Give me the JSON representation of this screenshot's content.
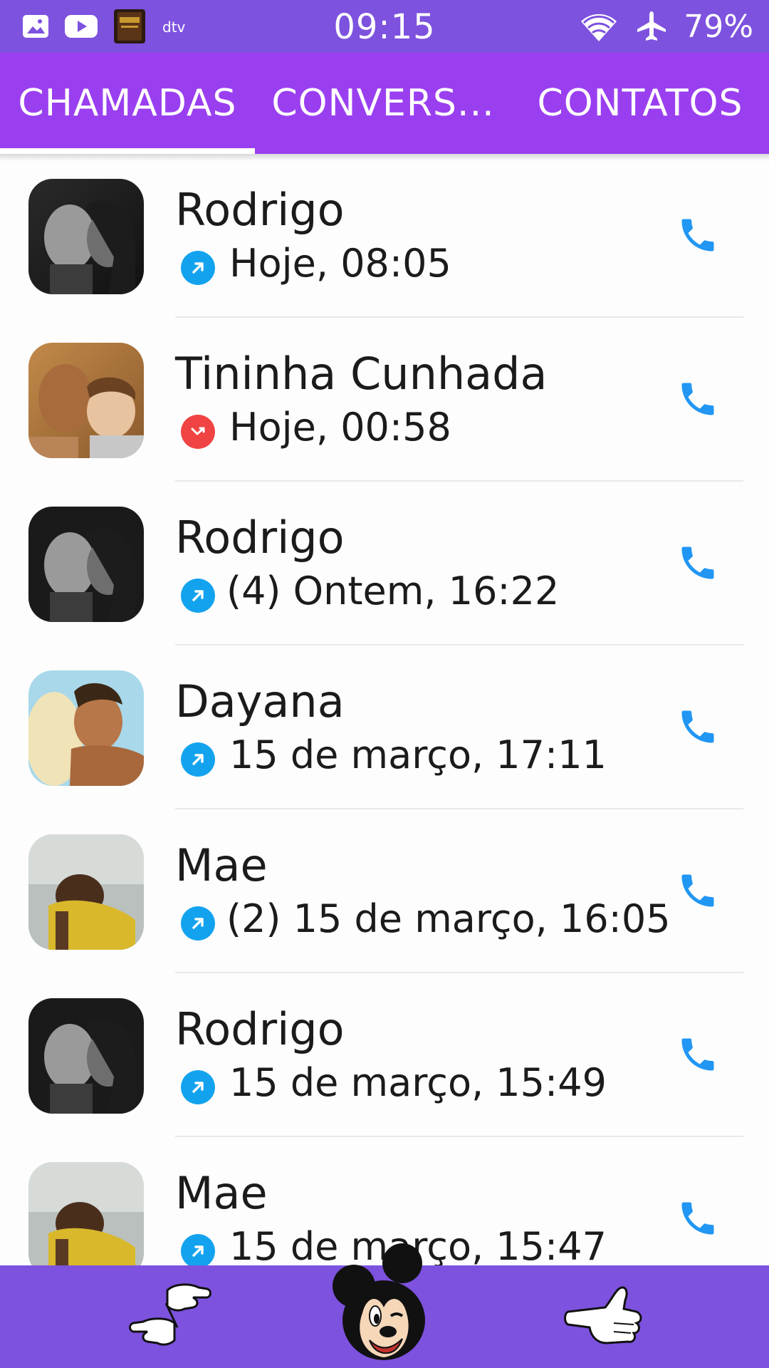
{
  "status_bar": {
    "time": "09:15",
    "battery": "79%",
    "left_icons": [
      "gallery-icon",
      "youtube-icon",
      "bible-app-icon",
      "dtv-icon"
    ],
    "right_icons": [
      "wifi-icon",
      "airplane-icon"
    ]
  },
  "tabs": [
    {
      "label": "CHAMADAS",
      "selected": true
    },
    {
      "label": "CONVERS...",
      "selected": false
    },
    {
      "label": "CONTATOS",
      "selected": false
    }
  ],
  "calls": [
    {
      "name": "Rodrigo",
      "detail": "Hoje, 08:05",
      "direction": "outgoing"
    },
    {
      "name": "Tininha Cunhada",
      "detail": "Hoje, 00:58",
      "direction": "missed"
    },
    {
      "name": "Rodrigo",
      "detail": "(4) Ontem, 16:22",
      "direction": "outgoing"
    },
    {
      "name": "Dayana",
      "detail": "15 de março, 17:11",
      "direction": "outgoing"
    },
    {
      "name": "Mae",
      "detail": "(2) 15 de março, 16:05",
      "direction": "outgoing"
    },
    {
      "name": "Rodrigo",
      "detail": "15 de março, 15:49",
      "direction": "outgoing"
    },
    {
      "name": "Mae",
      "detail": "15 de março, 15:47",
      "direction": "outgoing"
    }
  ],
  "bottom_bar": {
    "buttons": [
      "swap-hands-icon",
      "mickey-icon",
      "pointing-hand-icon"
    ]
  },
  "colors": {
    "status_bar": "#7d52de",
    "tab_bar": "#9a3ff0",
    "outgoing": "#13a3ee",
    "missed": "#f04343",
    "call_button": "#2196f3"
  }
}
